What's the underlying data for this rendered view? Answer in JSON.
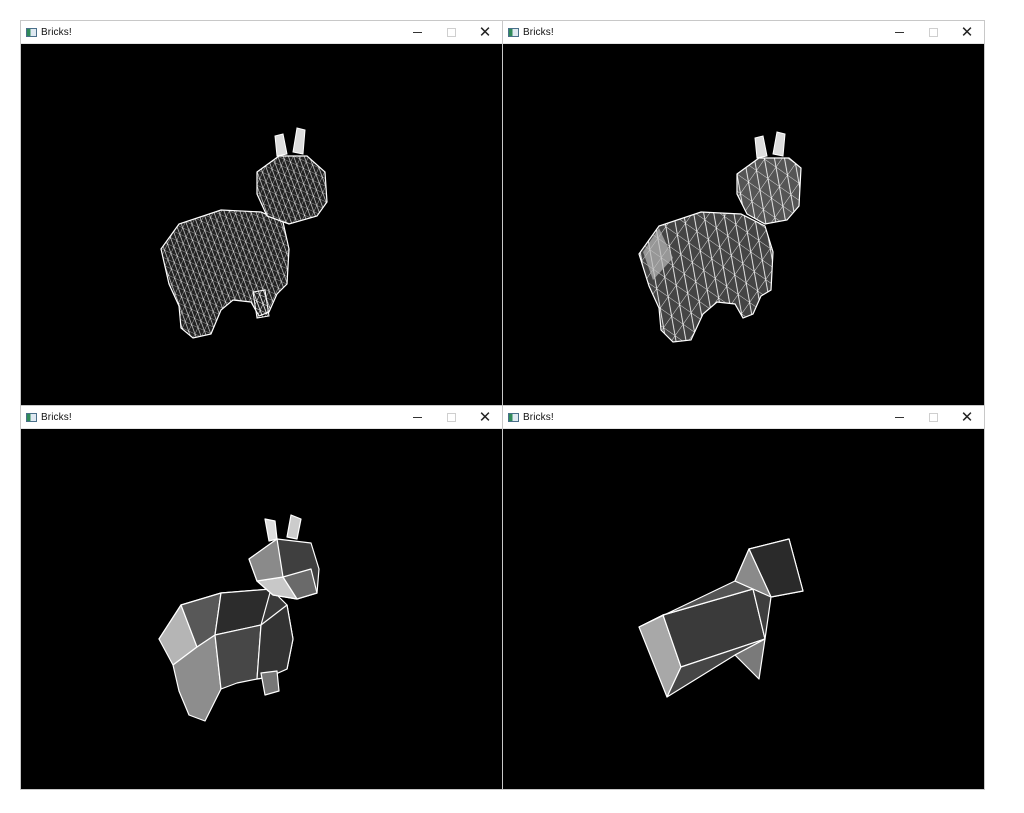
{
  "windows": [
    {
      "title": "Bricks!",
      "detail": "dense"
    },
    {
      "title": "Bricks!",
      "detail": "medium"
    },
    {
      "title": "Bricks!",
      "detail": "low"
    },
    {
      "title": "Bricks!",
      "detail": "minimal"
    }
  ],
  "controls": {
    "minimize": "–",
    "maximize": "□",
    "close": "✕"
  },
  "colors": {
    "background": "#000000",
    "wire": "#ffffff",
    "face_light": "#a9a9a9",
    "face_dark": "#3b3b3b"
  }
}
